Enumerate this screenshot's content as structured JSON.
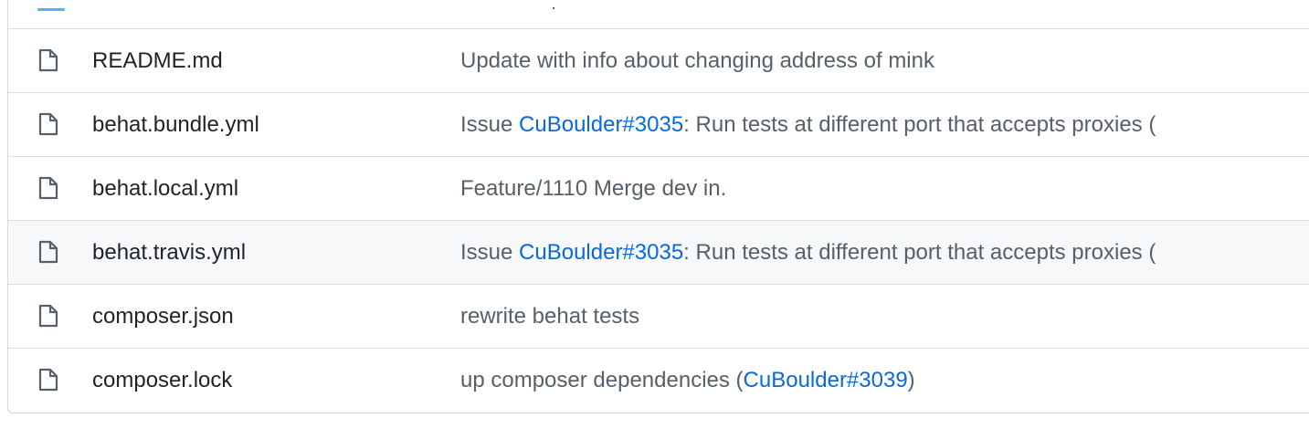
{
  "files": [
    {
      "name": "README.md",
      "icon": "file-icon",
      "message": [
        {
          "text": "Update with info about changing address of mink",
          "link": false
        }
      ]
    },
    {
      "name": "behat.bundle.yml",
      "icon": "file-icon",
      "message": [
        {
          "text": "Issue ",
          "link": false
        },
        {
          "text": "CuBoulder#3035",
          "link": true
        },
        {
          "text": ": Run tests at different port that accepts proxies (",
          "link": false
        }
      ]
    },
    {
      "name": "behat.local.yml",
      "icon": "file-icon",
      "message": [
        {
          "text": "Feature/1110 Merge dev in.",
          "link": false
        }
      ]
    },
    {
      "name": "behat.travis.yml",
      "icon": "file-icon",
      "hovered": true,
      "message": [
        {
          "text": "Issue ",
          "link": false
        },
        {
          "text": "CuBoulder#3035",
          "link": true
        },
        {
          "text": ": Run tests at different port that accepts proxies (",
          "link": false
        }
      ]
    },
    {
      "name": "composer.json",
      "icon": "file-icon",
      "message": [
        {
          "text": "rewrite behat tests",
          "link": false
        }
      ]
    },
    {
      "name": "composer.lock",
      "icon": "file-icon",
      "message": [
        {
          "text": "up composer dependencies (",
          "link": false
        },
        {
          "text": "CuBoulder#3039",
          "link": true
        },
        {
          "text": ")",
          "link": false
        }
      ]
    }
  ],
  "colors": {
    "link": "#0969da",
    "message": "#57606a",
    "filename": "#1f2328",
    "border": "#d0d7de",
    "hover_row": "#f6f8fa"
  }
}
